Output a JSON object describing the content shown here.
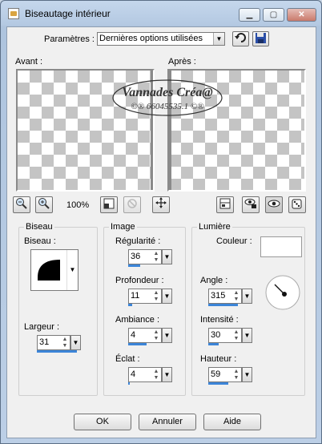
{
  "window": {
    "title": "Biseautage intérieur"
  },
  "top": {
    "params_label": "Paramètres :",
    "params_value": "Dernières options utilisées"
  },
  "preview": {
    "before_label": "Avant :",
    "after_label": "Après :"
  },
  "watermark": {
    "line1": "Vannades Créa@",
    "line2": "©® 66045535.1 ©®"
  },
  "toolbar": {
    "zoom": "100%"
  },
  "groups": {
    "biseau": {
      "title": "Biseau",
      "shape_label": "Biseau :",
      "width_label": "Largeur :",
      "width_value": "31",
      "width_level": 0.9
    },
    "image": {
      "title": "Image",
      "fields": [
        {
          "label": "Régularité :",
          "value": "36",
          "level": 0.36
        },
        {
          "label": "Profondeur :",
          "value": "11",
          "level": 0.11
        },
        {
          "label": "Ambiance :",
          "value": "4",
          "level": 0.55
        },
        {
          "label": "Éclat :",
          "value": "4",
          "level": 0.04
        }
      ]
    },
    "lumiere": {
      "title": "Lumière",
      "color_label": "Couleur :",
      "color_value": "#ffffff",
      "fields": [
        {
          "label": "Angle :",
          "value": "315",
          "level": 0.88
        },
        {
          "label": "Intensité :",
          "value": "30",
          "level": 0.3
        },
        {
          "label": "Hauteur :",
          "value": "59",
          "level": 0.59
        }
      ]
    }
  },
  "buttons": {
    "ok": "OK",
    "cancel": "Annuler",
    "help": "Aide"
  },
  "colors": {
    "accent": "#3c85d8",
    "checker": "#c4c4c4"
  }
}
